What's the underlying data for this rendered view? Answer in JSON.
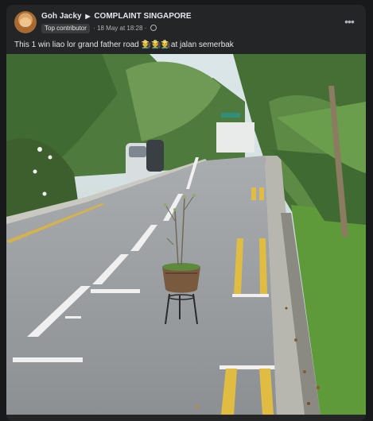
{
  "post": {
    "author": "Goh Jacky",
    "group": "COMPLAINT SINGAPORE",
    "badge": "Top contributor",
    "timestamp": "18 May at 18:28",
    "visibility_icon": "globe-icon",
    "more_icon": "more-options-icon",
    "caption": "This 1 win liao lor grand father road 🧑‍🌾🧑‍🌾🧑‍🌾at jalan semerbak"
  },
  "colors": {
    "background": "#18191a",
    "card": "#242526",
    "text": "#e4e6eb",
    "muted": "#b0b3b8"
  }
}
